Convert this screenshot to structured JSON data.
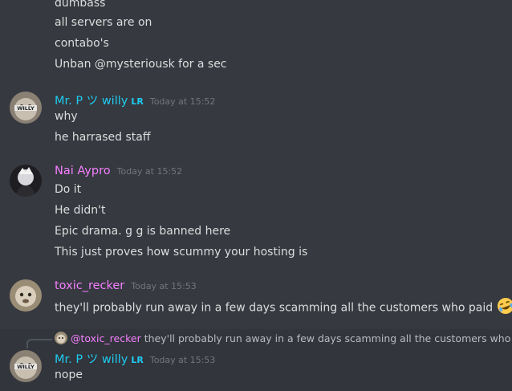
{
  "messages_top": [
    "dumbass",
    "all servers are on",
    "contabo's",
    "Unban @mysteriousk for a sec"
  ],
  "group1": {
    "username": "Mr. P ツ willy",
    "tag": "LR",
    "timestamp": "Today at 15:52",
    "lines": [
      "why",
      "he harrased staff"
    ]
  },
  "group2": {
    "username": "Nai Aypro",
    "timestamp": "Today at 15:52",
    "lines": [
      "Do it",
      "He didn't",
      "Epic drama. g g is banned here",
      "This just proves how scummy your hosting is"
    ]
  },
  "group3": {
    "username": "toxic_recker",
    "timestamp": "Today at 15:53",
    "lines": [
      "they'll probably run away in a few days scamming all the customers who paid"
    ],
    "emoji": "rofl-emoji"
  },
  "group4": {
    "reply_user": "@toxic_recker",
    "reply_text": "they'll probably run away in a few days scamming all the customers who paid",
    "username": "Mr. P ツ willy",
    "tag": "LR",
    "timestamp": "Today at 15:53",
    "lines": [
      "nope"
    ]
  },
  "colors": {
    "background": "#36393f",
    "text": "#dcddde",
    "username_blue": "#1ecbf2",
    "username_pink": "#f47fff",
    "timestamp": "#72767d"
  },
  "avatar_labels": {
    "willy": "WILLY"
  }
}
